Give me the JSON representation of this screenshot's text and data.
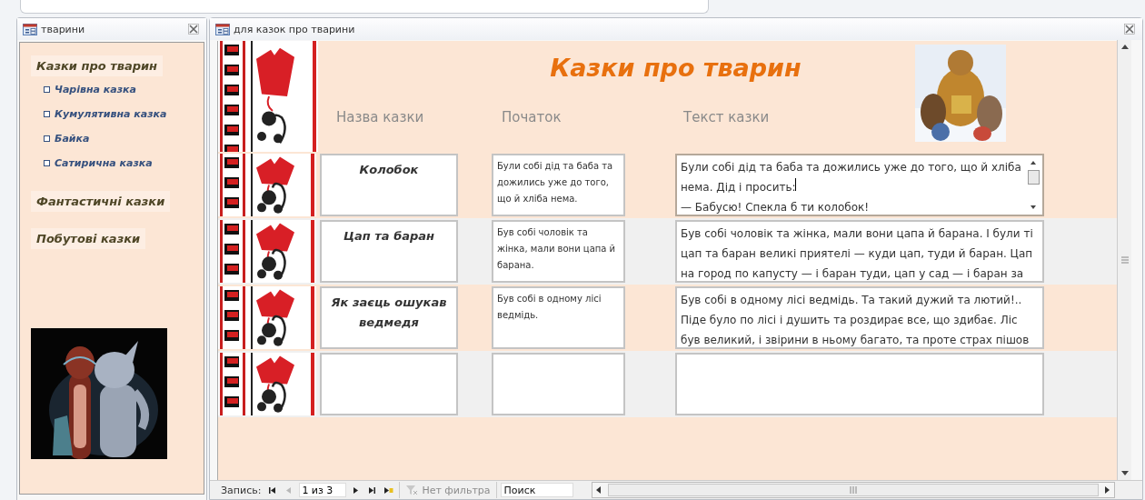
{
  "left_window": {
    "title": "тварини",
    "menu": [
      {
        "label": "Казки про тварин",
        "children": [
          {
            "label": "Чарівна казка"
          },
          {
            "label": "Кумулятивна казка"
          },
          {
            "label": "Байка"
          },
          {
            "label": "Сатирична казка"
          }
        ]
      },
      {
        "label": "Фантастичні казки"
      },
      {
        "label": "Побутові казки"
      }
    ]
  },
  "form_window": {
    "title": "для казок про тварини",
    "form_title": "Казки про тварин",
    "columns": [
      "Назва казки",
      "Початок",
      "Текст казки"
    ],
    "records": [
      {
        "kind": "record",
        "selected": true,
        "name": "Колобок",
        "start": "Були собі дід та баба та дожились уже до того, що й хліба нема.",
        "text": "Були собі дід та баба та дожились уже до того, що й хліба\nнема. Дід і просить:\n— Бабусю! Спекла б ти колобок!"
      },
      {
        "kind": "record",
        "selected": false,
        "name": "Цап та баран",
        "start": "Був собі чоловік та жінка, мали вони цапа й\n барана.",
        "text": "Був собі чоловік та жінка, мали вони цапа й барана. І були ті\n цап та баран великі приятелі — куди цап, туди й баран. Цап\nна город по капусту — і баран туди, цап у сад — і баран за"
      },
      {
        "kind": "record",
        "selected": false,
        "name": "Як заєць ошукав ведмедя",
        "start": "Був собі в одному лісі ведмідь.",
        "text": "Був собі в одному лісі ведмідь. Та такий дужий та лютий!..\nПіде було по лісі і душить та роздирає все, що здибає. Ліс\nбув великий, і звірини в ньому багато, та проте страх пішов"
      },
      {
        "kind": "new",
        "selected": false
      }
    ]
  },
  "navigation": {
    "label": "Запись:",
    "buttons": [
      {
        "kind": "first",
        "disabled": false
      },
      {
        "kind": "prev",
        "disabled": true
      }
    ],
    "record_field": "1 из 3",
    "buttons_after": [
      {
        "kind": "next",
        "disabled": false
      },
      {
        "kind": "last",
        "disabled": false
      },
      {
        "kind": "new",
        "disabled": false
      }
    ],
    "filter": {
      "label": "Нет фильтра",
      "disabled": true
    },
    "search": {
      "placeholder": "Поиск"
    }
  }
}
